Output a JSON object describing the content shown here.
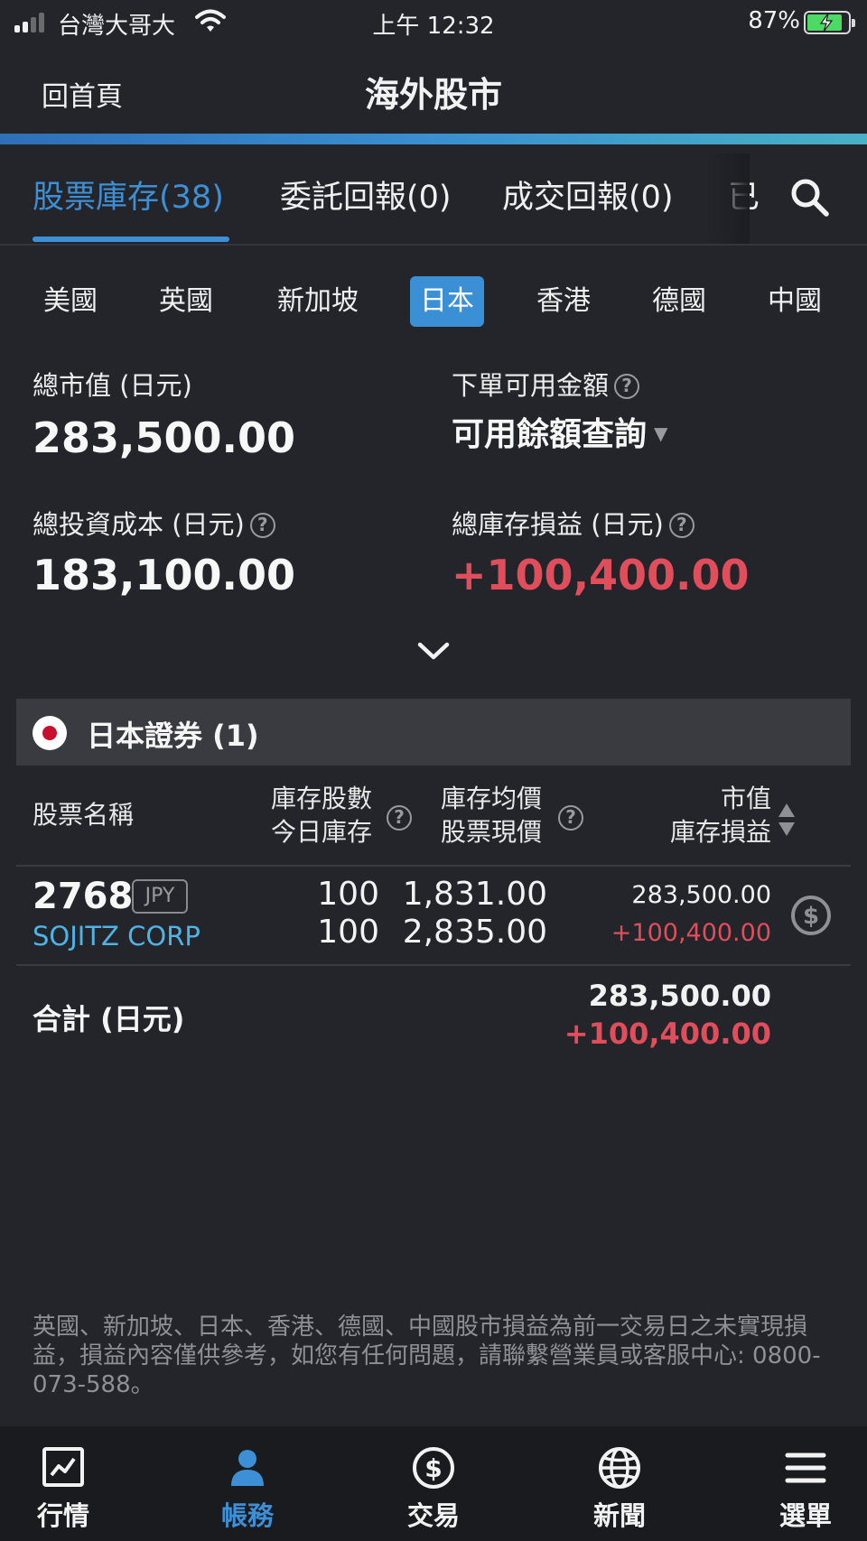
{
  "status_bar": {
    "carrier": "台灣大哥大",
    "time": "上午 12:32",
    "battery_percent": "87%",
    "battery_level": 0.87
  },
  "header": {
    "back_label": "回首頁",
    "title": "海外股市"
  },
  "tabs": [
    {
      "label": "股票庫存(38)",
      "active": true
    },
    {
      "label": "委託回報(0)",
      "active": false
    },
    {
      "label": "成交回報(0)",
      "active": false
    },
    {
      "label": "已",
      "active": false
    }
  ],
  "countries": [
    {
      "label": "美國",
      "active": false
    },
    {
      "label": "英國",
      "active": false
    },
    {
      "label": "新加坡",
      "active": false
    },
    {
      "label": "日本",
      "active": true
    },
    {
      "label": "香港",
      "active": false
    },
    {
      "label": "德國",
      "active": false
    },
    {
      "label": "中國",
      "active": false
    }
  ],
  "summary": {
    "market_value_label": "總市值 (日元)",
    "market_value": "283,500.00",
    "available_label": "下單可用金額",
    "available_link": "可用餘額查詢",
    "cost_label": "總投資成本 (日元)",
    "cost_value": "183,100.00",
    "pnl_label": "總庫存損益 (日元)",
    "pnl_value": "+100,400.00"
  },
  "broker": {
    "name": "日本證券 (1)"
  },
  "columns": {
    "name": "股票名稱",
    "shares_line1": "庫存股數",
    "shares_line2": "今日庫存",
    "price_line1": "庫存均價",
    "price_line2": "股票現價",
    "value_line1": "市值",
    "value_line2": "庫存損益"
  },
  "holdings": [
    {
      "code": "2768",
      "currency": "JPY",
      "name": "SOJITZ CORP",
      "shares": "100",
      "today_shares": "100",
      "avg_price": "1,831.00",
      "current_price": "2,835.00",
      "market_value": "283,500.00",
      "pnl": "+100,400.00"
    }
  ],
  "total": {
    "label": "合計 (日元)",
    "market_value": "283,500.00",
    "pnl": "+100,400.00"
  },
  "disclaimer": "英國、新加坡、日本、香港、德國、中國股市損益為前一交易日之未實現損益，損益內容僅供參考，如您有任何問題，請聯繫營業員或客服中心: 0800-073-588。",
  "bottom_nav": [
    {
      "label": "行情",
      "icon": "chart-icon",
      "active": false
    },
    {
      "label": "帳務",
      "icon": "person-icon",
      "active": true
    },
    {
      "label": "交易",
      "icon": "dollar-icon",
      "active": false
    },
    {
      "label": "新聞",
      "icon": "globe-icon",
      "active": false
    },
    {
      "label": "選單",
      "icon": "menu-icon",
      "active": false
    }
  ],
  "colors": {
    "background": "#24252b",
    "accent": "#3d8fd6",
    "profit_red": "#e04d5b",
    "stock_name_cyan": "#4fb3e6"
  }
}
